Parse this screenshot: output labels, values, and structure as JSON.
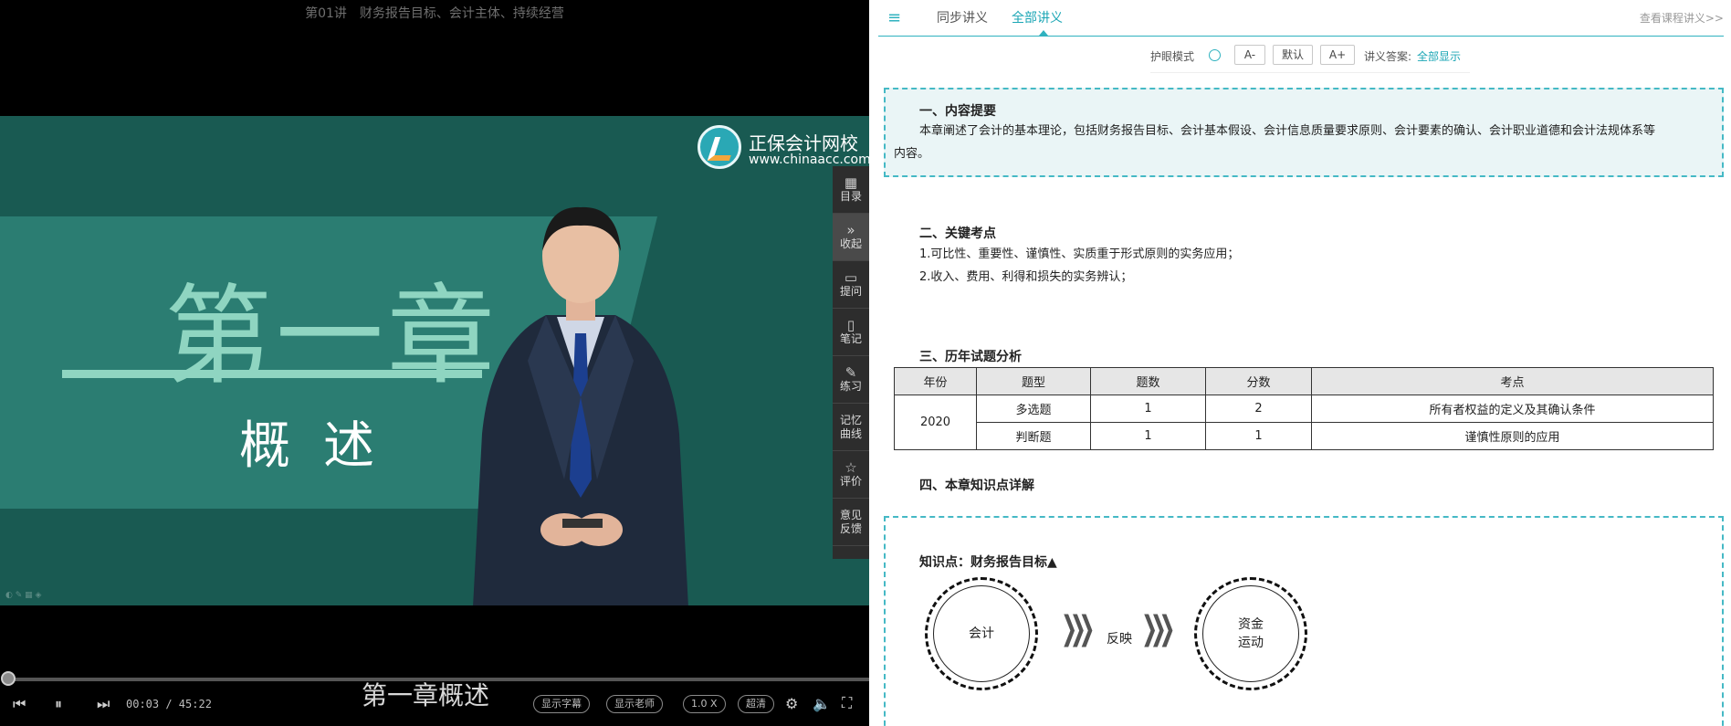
{
  "video": {
    "title": "第01讲　财务报告目标、会计主体、持续经营",
    "chapter_title": "第一章",
    "chapter_subtitle": "概述",
    "logo_name": "正保会计网校",
    "logo_url": "www.chinaacc.com",
    "subtitle_caption": "第一章概述",
    "time": "00:03 / 45:22",
    "progress_fraction": 0.001,
    "pills": [
      "显示字幕",
      "显示老师",
      "1.0 X",
      "超清"
    ],
    "side_tools": [
      {
        "label": "目录",
        "icon": "grid-icon"
      },
      {
        "label": "收起",
        "icon": "collapse-icon"
      },
      {
        "label": "提问",
        "icon": "question-icon"
      },
      {
        "label": "笔记",
        "icon": "note-icon"
      },
      {
        "label": "练习",
        "icon": "exercise-icon"
      },
      {
        "label1": "记忆",
        "label2": "曲线",
        "icon": "memory-icon"
      },
      {
        "label": "评价",
        "icon": "star-icon"
      },
      {
        "label1": "意见",
        "label2": "反馈",
        "icon": "feedback-icon"
      }
    ]
  },
  "handout": {
    "tabs": [
      "同步讲义",
      "全部讲义"
    ],
    "view_all": "查看课程讲义>>",
    "toolbar": {
      "eye_mode": "护眼模式",
      "font_smaller": "A-",
      "font_default": "默认",
      "font_larger": "A+",
      "answer_label": "讲义答案:",
      "answer_value": "全部显示"
    },
    "section1": {
      "heading": "一、内容提要",
      "line1": "本章阐述了会计的基本理论，包括财务报告目标、会计基本假设、会计信息质量要求原则、会计要素的确认、会计职业道德和会计法规体系等",
      "line2": "内容。"
    },
    "section2": {
      "heading": "二、关键考点",
      "item1": "1.可比性、重要性、谨慎性、实质重于形式原则的实务应用；",
      "item2": "2.收入、费用、利得和损失的实务辨认；"
    },
    "section3": {
      "heading": "三、历年试题分析",
      "columns": [
        "年份",
        "题型",
        "题数",
        "分数",
        "考点"
      ],
      "year": "2020",
      "rows": [
        [
          "多选题",
          "1",
          "2",
          "所有者权益的定义及其确认条件"
        ],
        [
          "判断题",
          "1",
          "1",
          "谨慎性原则的应用"
        ]
      ]
    },
    "section4": {
      "heading": "四、本章知识点详解",
      "kp_title": "知识点：财务报告目标▲",
      "circle_left": "会计",
      "arrow_label": "反映",
      "circle_right_1": "资金",
      "circle_right_2": "运动"
    }
  }
}
